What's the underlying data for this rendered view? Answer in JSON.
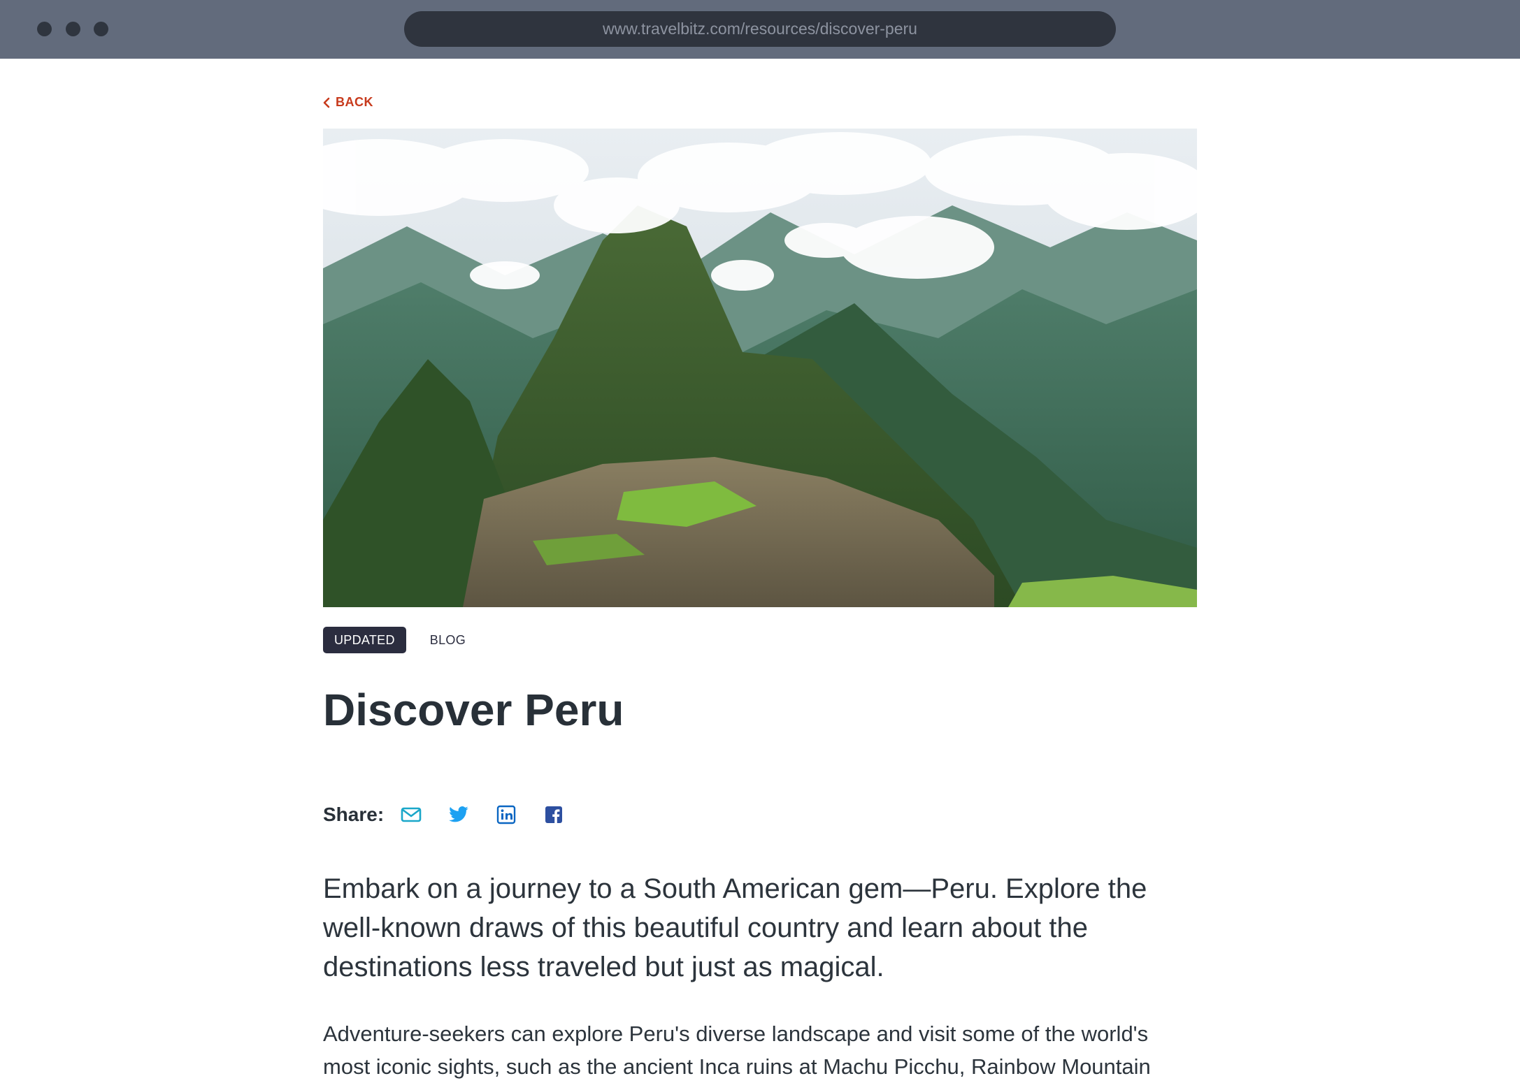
{
  "browser": {
    "url": "www.travelbitz.com/resources/discover-peru"
  },
  "nav": {
    "back_label": "BACK"
  },
  "hero": {
    "alt": "Machu Picchu mountain landscape"
  },
  "tags": {
    "updated": "UPDATED",
    "category": "BLOG"
  },
  "article": {
    "title": "Discover Peru",
    "share_label": "Share:",
    "lead": "Embark on a journey to a South American gem—Peru. Explore the well-known draws of this beautiful country and learn about the destinations less traveled but just as magical.",
    "body": "Adventure-seekers can explore Peru's diverse landscape and visit some of the world's most iconic sights, such as the ancient Inca ruins at Machu Picchu, Rainbow Mountain"
  },
  "share_icons": [
    {
      "name": "email-icon",
      "color": "#1aa7c9"
    },
    {
      "name": "twitter-icon",
      "color": "#1da1f2"
    },
    {
      "name": "linkedin-icon",
      "color": "#0a66c2"
    },
    {
      "name": "facebook-icon",
      "color": "#2d4fa0"
    }
  ],
  "colors": {
    "accent": "#c73a1c",
    "chrome": "#626b7c",
    "heading": "#283038"
  }
}
